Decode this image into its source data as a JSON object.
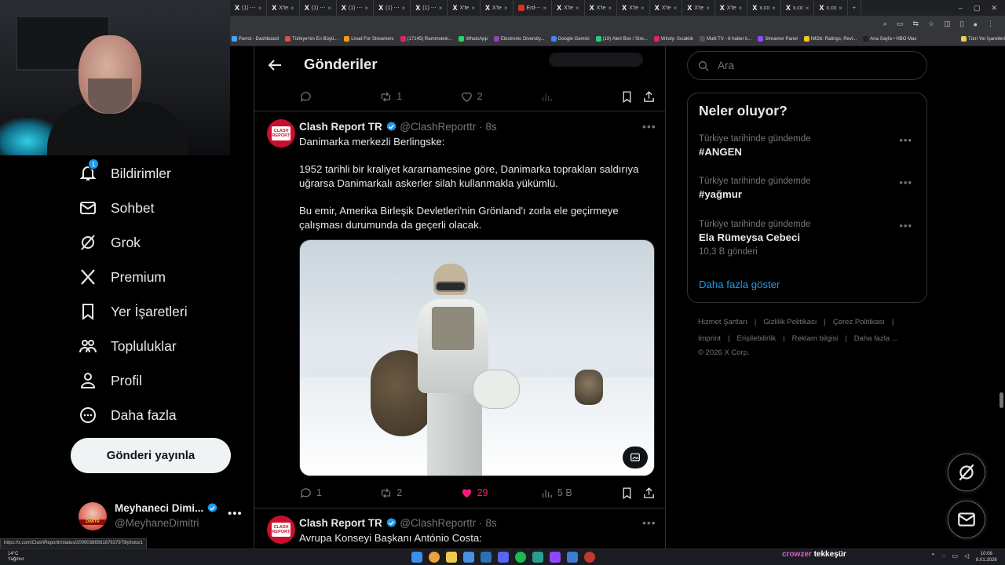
{
  "browser": {
    "tabs": [
      "(1) ⋯",
      "X'te",
      "(1) ⋯",
      "(1) ⋯",
      "(1) ⋯",
      "(1) ⋯",
      "X'te",
      "X'te",
      "Erd⋯",
      "X'te",
      "X'te",
      "X'te",
      "X'te",
      "X'te",
      "X'te",
      "x.co",
      "x.co",
      "x.co"
    ],
    "bookmarks": [
      "Parrot - Dashboard",
      "Türkiye'nin En Büyü...",
      "Livad For Streamers",
      "(17145) Rammstein...",
      "WhatsApp",
      "Electronic Diversity...",
      "Google Gemini",
      "(19) Alert Box / Stre...",
      "Windy: Sıcaklık",
      "Multi TV - 6 haber k...",
      "Streamer Panel",
      "IMDb: Ratings, Revi...",
      "Ana Sayfa • HBO Max",
      "Tüm Yer İşaretleri"
    ],
    "status_url": "https://x.com/ClashReporttr/status/2009038656187637979/photo/1"
  },
  "nav": {
    "items": [
      {
        "label": "Bildirimler",
        "icon": "bell-icon",
        "badge": "1"
      },
      {
        "label": "Sohbet",
        "icon": "mail-icon"
      },
      {
        "label": "Grok",
        "icon": "grok-icon"
      },
      {
        "label": "Premium",
        "icon": "x-logo-icon"
      },
      {
        "label": "Yer İşaretleri",
        "icon": "bookmark-icon"
      },
      {
        "label": "Topluluklar",
        "icon": "communities-icon"
      },
      {
        "label": "Profil",
        "icon": "person-icon"
      },
      {
        "label": "Daha fazla",
        "icon": "more-circle-icon"
      }
    ],
    "post_button": "Gönderi yayınla",
    "profile": {
      "name": "Meyhaneci Dimi...",
      "handle": "@MeyhaneDimitri",
      "avatar_band": "DIMITR"
    }
  },
  "header": {
    "title": "Gönderiler"
  },
  "prev_actions": {
    "replies": "",
    "reposts": "1",
    "likes": "2"
  },
  "tweets": [
    {
      "name": "Clash Report TR",
      "handle": "@ClashReporttr",
      "time": "8s",
      "avatar_text": "CLASH REPORT",
      "paragraphs": [
        "Danimarka merkezli Berlingske:",
        "1952 tarihli bir kraliyet kararnamesine göre, Danimarka toprakları saldırıya uğrarsa Danimarkalı askerler silah kullanmakla yükümlü.",
        "Bu emir, Amerika Birleşik Devletleri'nin Grönland'ı zorla ele geçirmeye çalışması durumunda da geçerli olacak."
      ],
      "actions": {
        "replies": "1",
        "reposts": "2",
        "likes": "29",
        "views": "5 B"
      },
      "like_color": "#f91880"
    },
    {
      "name": "Clash Report TR",
      "handle": "@ClashReporttr",
      "time": "8s",
      "avatar_text": "CLASH REPORT",
      "paragraphs": [
        "Avrupa Konseyi Başkanı António Costa:"
      ]
    }
  ],
  "search": {
    "placeholder": "Ara"
  },
  "trends": {
    "title": "Neler oluyor?",
    "items": [
      {
        "category": "Türkiye tarihinde gündemde",
        "name": "#ANGEN",
        "count": ""
      },
      {
        "category": "Türkiye tarihinde gündemde",
        "name": "#yağmur",
        "count": ""
      },
      {
        "category": "Türkiye tarihinde gündemde",
        "name": "Ela Rümeysa Cebeci",
        "count": "10,3 B gönderi"
      }
    ],
    "show_more": "Daha fazla göster"
  },
  "footer": {
    "row1": [
      "Hizmet Şartları",
      "Gizlilik Politikası",
      "Çerez Politikası"
    ],
    "row2": [
      "Imprint",
      "Erişilebilirlik",
      "Reklam bilgisi",
      "Daha fazla ..."
    ],
    "copyright": "© 2026 X Corp."
  },
  "taskbar": {
    "weather_temp": "14°C",
    "weather_desc": "Yağmur",
    "stream_left": "crowzer",
    "stream_right": "tekkeşür",
    "time": "10:08",
    "date": "8.01.2026"
  },
  "colors": {
    "accent": "#1d9bf0",
    "like": "#f91880",
    "border": "#2f3336",
    "muted": "#71767b"
  }
}
